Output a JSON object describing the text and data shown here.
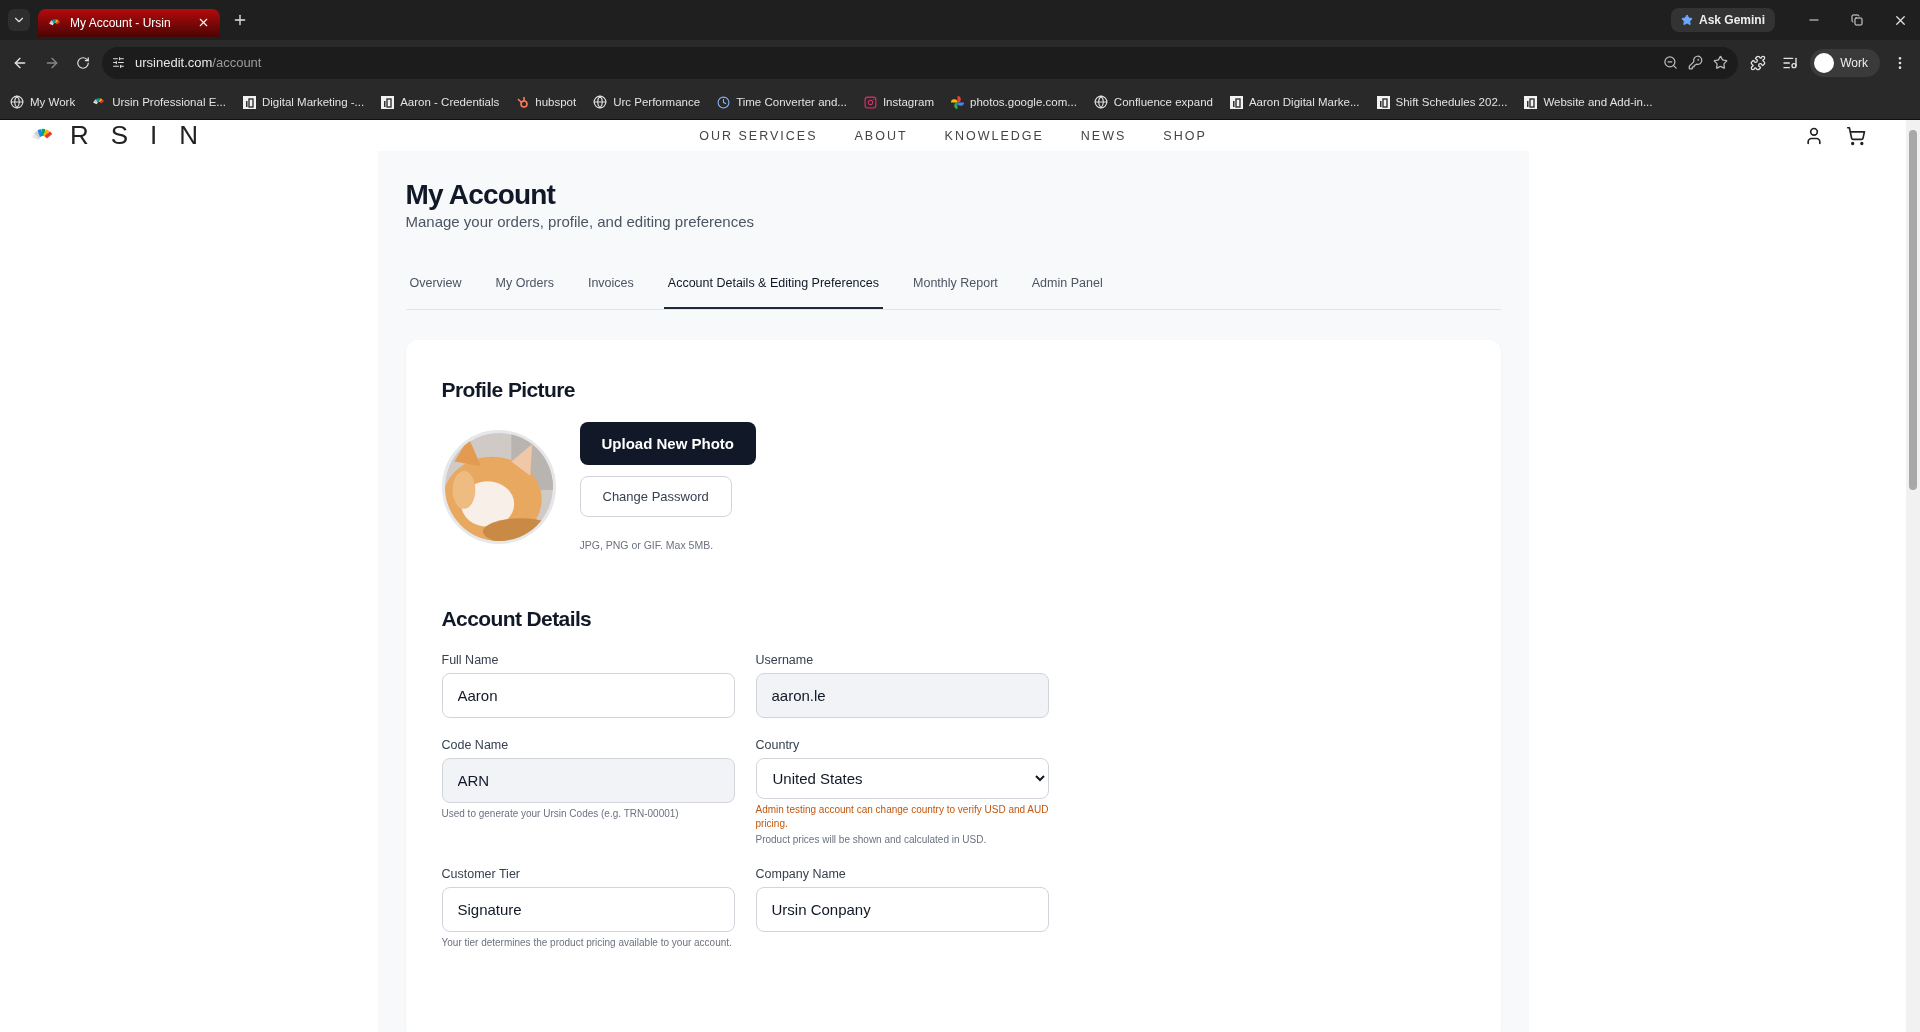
{
  "browser": {
    "tab_title": "My Account - Ursin",
    "ask_button": "Ask Gemini",
    "url_host": "ursinedit.com",
    "url_path": "/account",
    "profile": "Work",
    "bookmarks": [
      {
        "label": "My Work",
        "kind": "globe"
      },
      {
        "label": "Ursin Professional E...",
        "kind": "ursin"
      },
      {
        "label": "Digital Marketing -...",
        "kind": "doc"
      },
      {
        "label": "Aaron - Credentials",
        "kind": "doc"
      },
      {
        "label": "hubspot",
        "kind": "hubspot"
      },
      {
        "label": "Urc Performance",
        "kind": "globe"
      },
      {
        "label": "Time Converter and...",
        "kind": "clock"
      },
      {
        "label": "Instagram",
        "kind": "instagram"
      },
      {
        "label": "photos.google.com...",
        "kind": "photos"
      },
      {
        "label": "Confluence expand",
        "kind": "globe"
      },
      {
        "label": "Aaron Digital Marke...",
        "kind": "doc"
      },
      {
        "label": "Shift Schedules 202...",
        "kind": "doc"
      },
      {
        "label": "Website and Add-in...",
        "kind": "doc"
      }
    ]
  },
  "site": {
    "logo": "RSIN",
    "nav": [
      "OUR SERVICES",
      "ABOUT",
      "KNOWLEDGE",
      "NEWS",
      "SHOP"
    ]
  },
  "page": {
    "title": "My Account",
    "subtitle": "Manage your orders, profile, and editing preferences",
    "tabs": [
      {
        "label": "Overview",
        "selected": false
      },
      {
        "label": "My Orders",
        "selected": false
      },
      {
        "label": "Invoices",
        "selected": false
      },
      {
        "label": "Account Details & Editing Preferences",
        "selected": true
      },
      {
        "label": "Monthly Report",
        "selected": false
      },
      {
        "label": "Admin Panel",
        "selected": false
      }
    ]
  },
  "profile_picture": {
    "heading": "Profile Picture",
    "upload_button": "Upload New Photo",
    "password_button": "Change Password",
    "note": "JPG, PNG or GIF. Max 5MB."
  },
  "account_details": {
    "heading": "Account Details",
    "fields": [
      {
        "label": "Full Name",
        "value": "Aaron",
        "kind": "text",
        "disabled": false
      },
      {
        "label": "Username",
        "value": "aaron.le",
        "kind": "text",
        "disabled": true
      },
      {
        "label": "Code Name",
        "value": "ARN",
        "kind": "text",
        "disabled": true,
        "hints": [
          {
            "text": "Used to generate your Ursin Codes (e.g. TRN-00001)",
            "kind": "note"
          }
        ]
      },
      {
        "label": "Country",
        "value": "United States",
        "kind": "select",
        "disabled": false,
        "hints": [
          {
            "text": "Admin testing account can change country to verify USD and AUD pricing.",
            "kind": "warning"
          },
          {
            "text": "Product prices will be shown and calculated in USD.",
            "kind": "note"
          }
        ]
      },
      {
        "label": "Customer Tier",
        "value": "Signature",
        "kind": "text",
        "disabled": false,
        "hints": [
          {
            "text": "Your tier determines the product pricing available to your account.",
            "kind": "note"
          }
        ]
      },
      {
        "label": "Company Name",
        "value": "Ursin Conpany",
        "kind": "text",
        "disabled": false
      }
    ]
  }
}
